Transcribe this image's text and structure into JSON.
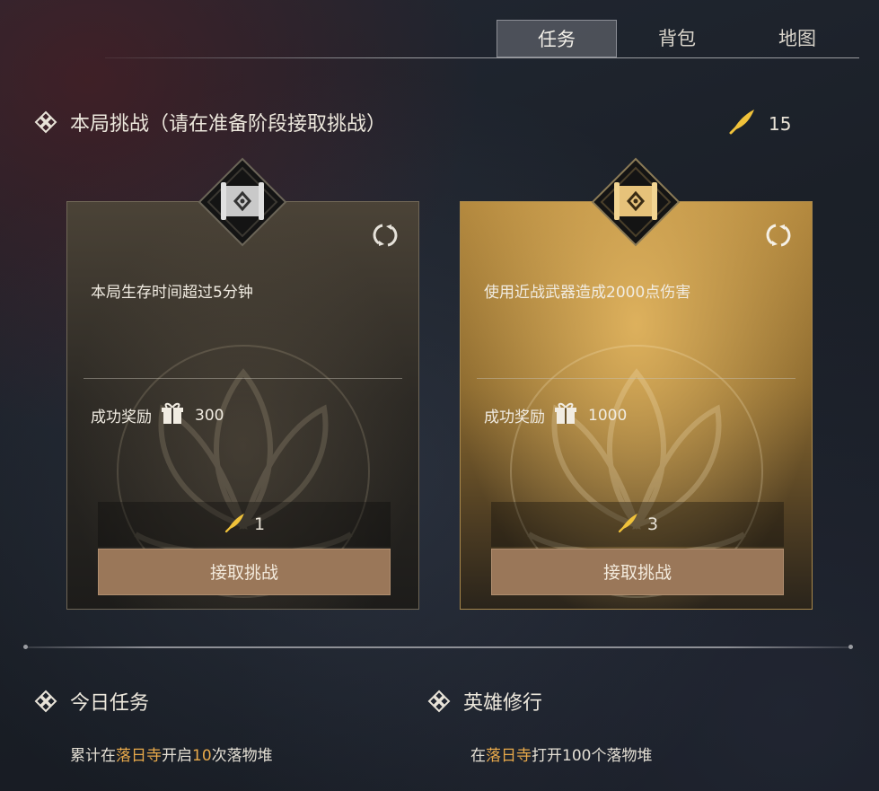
{
  "tabs": [
    {
      "label": "任务",
      "active": true
    },
    {
      "label": "背包",
      "active": false
    },
    {
      "label": "地图",
      "active": false
    }
  ],
  "challenge_section": {
    "title": "本局挑战（请在准备阶段接取挑战）",
    "currency_icon": "feather-icon",
    "currency_amount": "15"
  },
  "cards": [
    {
      "style": "dark",
      "description": "本局生存时间超过5分钟",
      "reward_label": "成功奖励",
      "reward_icon": "gift-icon",
      "reward_amount": "300",
      "cost": "1",
      "button_label": "接取挑战"
    },
    {
      "style": "gold",
      "description": "使用近战武器造成2000点伤害",
      "reward_label": "成功奖励",
      "reward_icon": "gift-icon",
      "reward_amount": "1000",
      "cost": "3",
      "button_label": "接取挑战"
    }
  ],
  "daily_tasks": {
    "title": "今日任务",
    "text_parts": [
      "累计在",
      "落日寺",
      "开启",
      "10",
      "次落物堆"
    ]
  },
  "hero_training": {
    "title": "英雄修行",
    "text_parts": [
      "在",
      "落日寺",
      "打开100个落物堆"
    ]
  },
  "colors": {
    "highlight": "#e8a94a",
    "button": "#9a7759",
    "gold_card": "#b58a3f",
    "feather": "#f0c23a"
  }
}
